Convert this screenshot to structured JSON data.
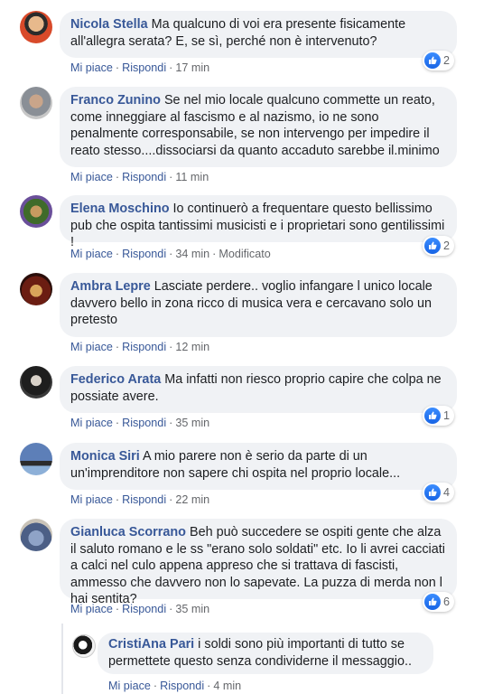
{
  "actions": {
    "like": "Mi piace",
    "reply": "Rispondi",
    "separator": "·",
    "edited": "Modificato"
  },
  "comments": [
    {
      "author": "Nicola Stella",
      "text": "Ma qualcuno di voi era presente fisicamente all'allegra serata? E, se sì, perché non è intervenuto?",
      "time": "17 min",
      "likes": "2"
    },
    {
      "author": "Franco Zunino",
      "text": "Se nel mio locale qualcuno commette un reato, come inneggiare al fascismo e al nazismo, io ne sono penalmente corresponsabile, se non intervengo per impedire il reato stesso....dissociarsi da quanto accaduto sarebbe il.minimo",
      "time": "11 min"
    },
    {
      "author": "Elena Moschino",
      "text": "Io continuerò a frequentare questo bellissimo pub che ospita tantissimi musicisti e i proprietari sono gentilissimi !",
      "time": "34 min",
      "likes": "2"
    },
    {
      "author": "Ambra Lepre",
      "text": "Lasciate perdere.. voglio infangare l unico locale davvero bello in zona ricco di musica vera e cercavano solo un pretesto",
      "time": "12 min"
    },
    {
      "author": "Federico Arata",
      "text": "Ma infatti non riesco proprio capire che colpa ne possiate avere.",
      "time": "35 min",
      "likes": "1"
    },
    {
      "author": "Monica Siri",
      "text": "A mio parere non è serio da parte di un un'imprenditore non sapere chi ospita nel proprio locale...",
      "time": "22 min",
      "likes": "4"
    },
    {
      "author": "Gianluca Scorrano",
      "text": "Beh può succedere se ospiti gente che alza il saluto romano e le ss \"erano solo soldati\" etc. Io li avrei cacciati a calci nel culo appena appreso che si trattava di fascisti, ammesso che davvero non lo sapevate. La puzza di merda non l hai sentita?",
      "time": "35 min",
      "likes": "6"
    }
  ],
  "reply": {
    "author": "CristiAna Pari",
    "text": "i soldi sono più importanti di tutto se permettete questo senza condividerne il messaggio..",
    "time": "4 min"
  },
  "colors": {
    "author": "#385898",
    "bubble": "#f0f2f5",
    "meta": "#65676b",
    "like": "#1877f2"
  }
}
